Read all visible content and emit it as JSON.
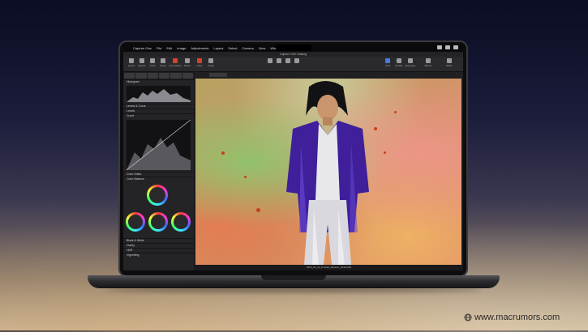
{
  "menubar": {
    "app_name": "Capture One",
    "items": [
      "File",
      "Edit",
      "Image",
      "Adjustments",
      "Layers",
      "Select",
      "Camera",
      "View",
      "Window",
      "Scripts",
      "Help"
    ]
  },
  "window": {
    "title": "Capture One Catalog"
  },
  "toolbar": {
    "tools": [
      {
        "label": "Import",
        "icon": "import-icon"
      },
      {
        "label": "Export",
        "icon": "export-icon"
      },
      {
        "label": "Undo",
        "icon": "undo-icon"
      },
      {
        "label": "Redo",
        "icon": "redo-icon"
      },
      {
        "label": "Auto Adjust",
        "icon": "auto-adjust-icon"
      },
      {
        "label": "Reset",
        "icon": "reset-icon"
      },
      {
        "label": "Copy",
        "icon": "copy-icon"
      },
      {
        "label": "Apply",
        "icon": "apply-icon"
      }
    ],
    "right_tools": [
      "Grid",
      "Guides",
      "Exposure",
      "Proof",
      "Before",
      "Compare",
      "Share"
    ]
  },
  "panel": {
    "sections": [
      "Histogram",
      "Levels & Curve",
      "Levels",
      "Curve",
      "Color Editor",
      "Color Balance",
      "Black & White",
      "Clarity",
      "HDR",
      "Vignetting"
    ]
  },
  "viewer": {
    "caption": "2023_04_12_Portrait_Session_Final.CR3"
  },
  "watermark": {
    "text": "www.macrumors.com"
  },
  "colors": {
    "accent": "#4a7be0",
    "background_top": "#0b0d24",
    "background_bottom": "#c9b79b"
  }
}
